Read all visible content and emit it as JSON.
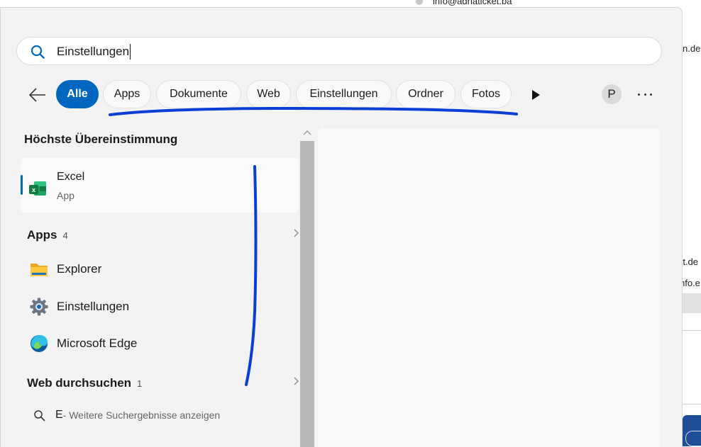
{
  "background": {
    "email_top": "info@adriaticket.ba",
    "snippet_1": "n.de",
    "snippet_2": "rt.de",
    "snippet_3": "nfo.e"
  },
  "search": {
    "value": "Einstellungen",
    "icon": "search-icon"
  },
  "filters": {
    "back_icon": "arrow-left-icon",
    "chips": [
      "Alle",
      "Apps",
      "Dokumente",
      "Web",
      "Einstellungen",
      "Ordner",
      "Fotos"
    ],
    "active": "Alle",
    "more_icon": "play-arrow-icon",
    "avatar_letter": "P",
    "more_options_icon": "ellipsis-icon"
  },
  "best_match": {
    "heading": "Höchste Übereinstimmung",
    "name": "Excel",
    "kind": "App",
    "icon": "excel-icon"
  },
  "apps": {
    "heading": "Apps",
    "count": "4",
    "items": [
      {
        "label": "Explorer",
        "icon": "folder-icon"
      },
      {
        "label": "Einstellungen",
        "icon": "gear-icon"
      },
      {
        "label": "Microsoft Edge",
        "icon": "edge-icon"
      }
    ]
  },
  "web": {
    "heading": "Web durchsuchen",
    "count": "1",
    "query": "E",
    "hint": " - Weitere Suchergebnisse anzeigen"
  },
  "colors": {
    "accent": "#0067c0",
    "annotation": "#0a3fd6",
    "panel": "#f3f3f3"
  }
}
